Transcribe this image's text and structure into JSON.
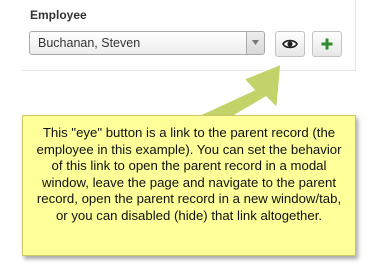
{
  "form": {
    "employee_label": "Employee",
    "employee_selected": "Buchanan, Steven"
  },
  "buttons": {
    "view_icon": "eye-icon",
    "add_icon": "plus-icon"
  },
  "callout": {
    "text": "This \"eye\" button is a link to the parent record (the employee in this example). You can set the behavior of this link to open the parent record in a modal window, leave the page and navigate to the parent record, open the parent record in a new window/tab, or you can disabled (hide) that link altogether."
  },
  "colors": {
    "callout_background": "#ffff99",
    "arrow": "#c3d36a",
    "add_icon": "#2e8b2e"
  }
}
